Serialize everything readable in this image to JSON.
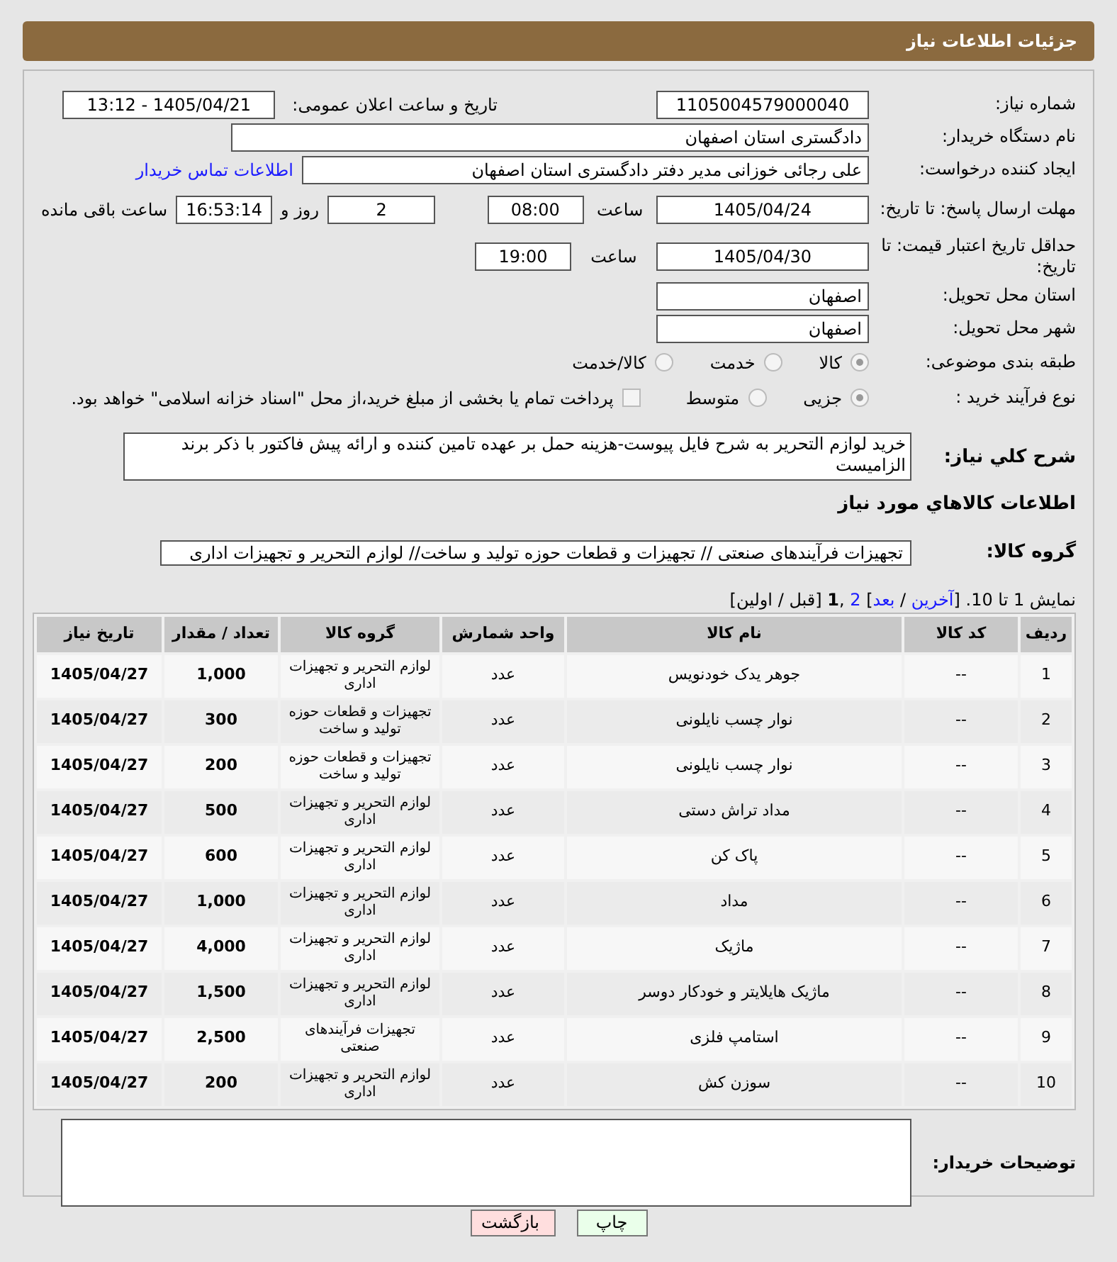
{
  "header": {
    "title": "جزئیات اطلاعات نیاز"
  },
  "need_number": {
    "label": "شماره نیاز:",
    "value": "1105004579000040"
  },
  "announce": {
    "label": "تاریخ و ساعت اعلان عمومی:",
    "value": "1405/04/21 - 13:12"
  },
  "buyer_org": {
    "label": "نام دستگاه خریدار:",
    "value": "دادگستری استان اصفهان"
  },
  "requester": {
    "label": "ایجاد کننده درخواست:",
    "value": "علی رجائی خوزانی مدیر دفتر دادگستری استان اصفهان",
    "link": "اطلاعات تماس خریدار"
  },
  "reply_deadline": {
    "label": "مهلت ارسال پاسخ: تا تاریخ:",
    "date": "1405/04/24",
    "time_label": "ساعت",
    "time": "08:00",
    "days": "2",
    "days_label": "روز و",
    "remaining": "16:53:14",
    "remaining_label": "ساعت باقی مانده"
  },
  "price_validity": {
    "label": "حداقل تاریخ اعتبار قیمت: تا تاریخ:",
    "date": "1405/04/30",
    "time_label": "ساعت",
    "time": "19:00"
  },
  "province": {
    "label": "استان محل تحویل:",
    "value": "اصفهان"
  },
  "city": {
    "label": "شهر محل تحویل:",
    "value": "اصفهان"
  },
  "category": {
    "label": "طبقه بندی موضوعی:",
    "options": [
      {
        "label": "کالا",
        "selected": true
      },
      {
        "label": "خدمت",
        "selected": false
      },
      {
        "label": "کالا/خدمت",
        "selected": false
      }
    ]
  },
  "purchase_type": {
    "label": "نوع فرآیند خرید :",
    "options": [
      {
        "label": "جزیی",
        "selected": true
      },
      {
        "label": "متوسط",
        "selected": false
      }
    ],
    "payment": {
      "label": "پرداخت تمام یا بخشی از مبلغ خرید،از محل \"اسناد خزانه اسلامی\" خواهد بود.",
      "checked": false
    }
  },
  "description": {
    "label": "شرح کلي نياز:",
    "value": "خرید لوازم التحریر به شرح فایل پیوست-هزینه حمل بر عهده تامین کننده و ارائه پیش فاکتور با ذکر برند الزامیست"
  },
  "items_heading": "اطلاعات کالاهاي مورد نياز",
  "goods_group": {
    "label": "گروه کالا:",
    "value": "تجهیزات فرآیندهای صنعتی // تجهیزات و قطعات حوزه تولید و ساخت// لوازم التحریر و تجهیزات اداری"
  },
  "pagination": [
    {
      "kind": "text",
      "text": "نمایش 1 تا 10. ["
    },
    {
      "kind": "link",
      "text": "آخرین"
    },
    {
      "kind": "text",
      "text": " / "
    },
    {
      "kind": "link",
      "text": "بعد"
    },
    {
      "kind": "text",
      "text": "] "
    },
    {
      "kind": "link",
      "text": "2"
    },
    {
      "kind": "text",
      "text": " ,"
    },
    {
      "kind": "current",
      "text": "1"
    },
    {
      "kind": "text",
      "text": " [قبل / اولین]"
    }
  ],
  "table": {
    "columns": [
      "ردیف",
      "کد کالا",
      "نام کالا",
      "واحد شمارش",
      "گروه کالا",
      "تعداد / مقدار",
      "تاریخ نیاز"
    ],
    "rows": [
      [
        "1",
        "--",
        "جوهر یدک خودنویس",
        "عدد",
        "لوازم التحریر و تجهیزات اداری",
        "1,000",
        "1405/04/27"
      ],
      [
        "2",
        "--",
        "نوار چسب نایلونی",
        "عدد",
        "تجهیزات و قطعات حوزه تولید و ساخت",
        "300",
        "1405/04/27"
      ],
      [
        "3",
        "--",
        "نوار چسب نایلونی",
        "عدد",
        "تجهیزات و قطعات حوزه تولید و ساخت",
        "200",
        "1405/04/27"
      ],
      [
        "4",
        "--",
        "مداد تراش دستی",
        "عدد",
        "لوازم التحریر و تجهیزات اداری",
        "500",
        "1405/04/27"
      ],
      [
        "5",
        "--",
        "پاک کن",
        "عدد",
        "لوازم التحریر و تجهیزات اداری",
        "600",
        "1405/04/27"
      ],
      [
        "6",
        "--",
        "مداد",
        "عدد",
        "لوازم التحریر و تجهیزات اداری",
        "1,000",
        "1405/04/27"
      ],
      [
        "7",
        "--",
        "ماژیک",
        "عدد",
        "لوازم التحریر و تجهیزات اداری",
        "4,000",
        "1405/04/27"
      ],
      [
        "8",
        "--",
        "ماژیک هایلایتر و خودکار دوسر",
        "عدد",
        "لوازم التحریر و تجهیزات اداری",
        "1,500",
        "1405/04/27"
      ],
      [
        "9",
        "--",
        "استامپ فلزی",
        "عدد",
        "تجهیزات فرآیندهای صنعتی",
        "2,500",
        "1405/04/27"
      ],
      [
        "10",
        "--",
        "سوزن کش",
        "عدد",
        "لوازم التحریر و تجهیزات اداری",
        "200",
        "1405/04/27"
      ]
    ]
  },
  "buyer_notes": {
    "label": "توضیحات خریدار:"
  },
  "buttons": [
    {
      "kind": "print",
      "label": "چاپ"
    },
    {
      "kind": "back",
      "label": "بازگشت"
    }
  ]
}
